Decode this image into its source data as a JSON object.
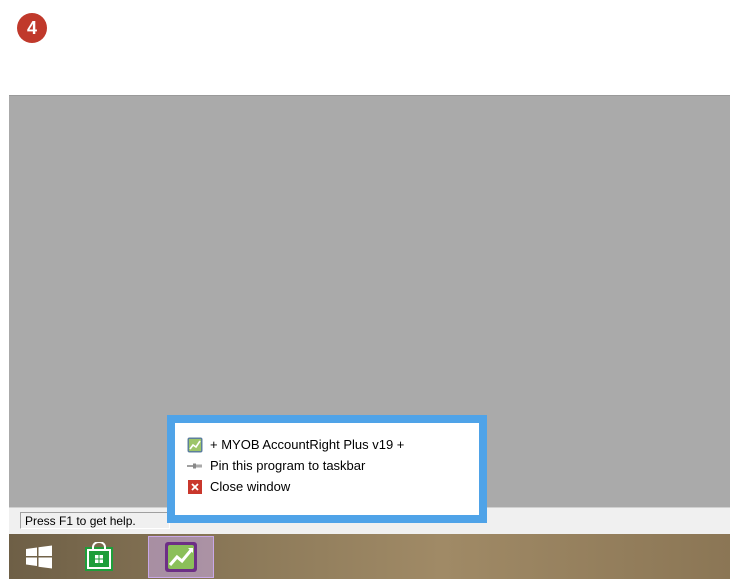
{
  "step_badge": "4",
  "status_bar": {
    "text": "Press F1 to get help."
  },
  "jump_list": {
    "items": [
      {
        "label": "+ MYOB AccountRight Plus v19 +",
        "icon": "myob-app-icon"
      },
      {
        "label": "Pin this program to taskbar",
        "icon": "pin-icon"
      },
      {
        "label": "Close window",
        "icon": "close-icon"
      }
    ]
  },
  "taskbar": {
    "buttons": [
      {
        "name": "start",
        "icon": "windows-logo-icon"
      },
      {
        "name": "store",
        "icon": "store-bag-icon"
      },
      {
        "name": "myob",
        "icon": "myob-chart-icon"
      }
    ]
  },
  "colors": {
    "badge": "#c0392b",
    "window_bg": "#aaaaaa",
    "jumplist_border": "#4fa3e8",
    "store_green": "#1e9e3a"
  }
}
